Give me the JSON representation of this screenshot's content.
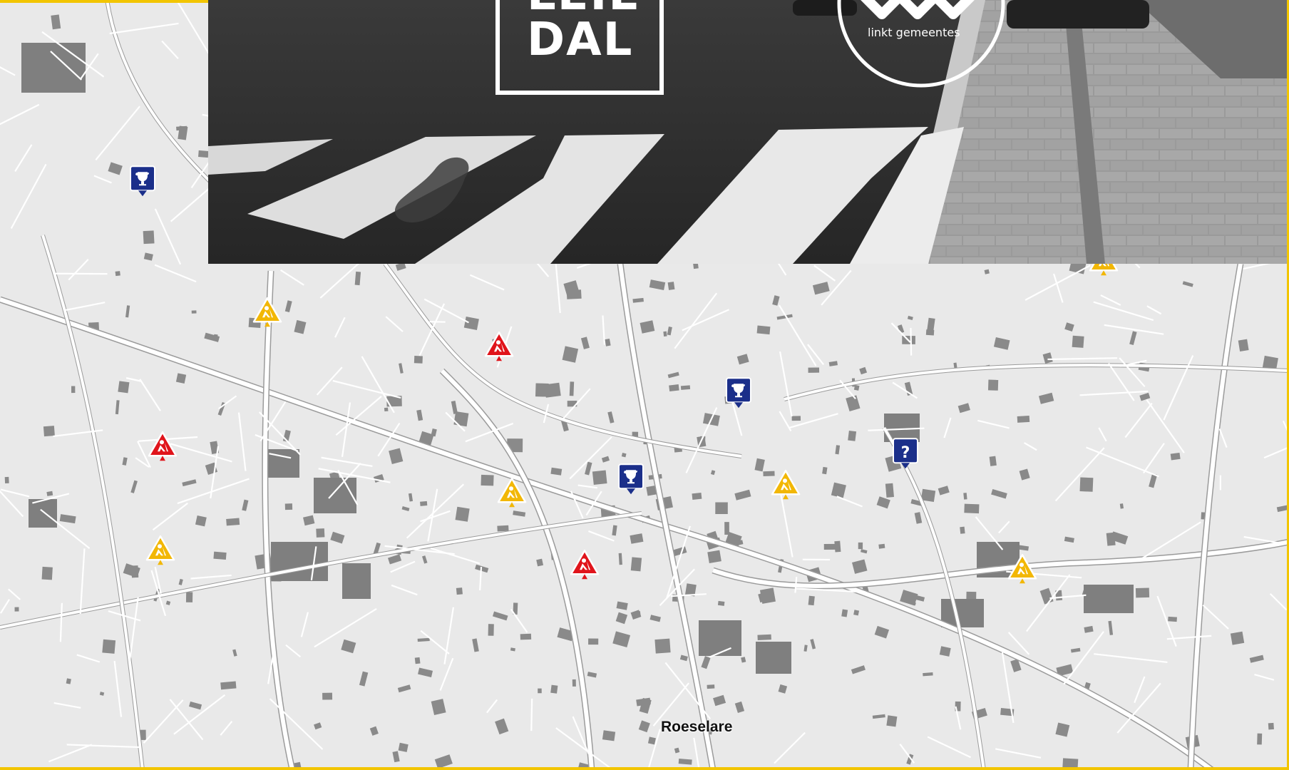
{
  "colors": {
    "accent_yellow": "#f2c500",
    "map_background": "#e9e9e9",
    "road": "#ffffff",
    "building": "#8a8a8a",
    "marker_blue": "#1b2f8a",
    "marker_yellow": "#f2b705",
    "marker_red": "#e0141b"
  },
  "hero": {
    "logo_left_line1": "LEIE",
    "logo_left_line2": "DAL",
    "logo_right_tagline": "linkt gemeentes"
  },
  "map": {
    "place_label": "Roeselare",
    "markers": [
      {
        "type": "event",
        "icon": "trophy-icon",
        "color": "blue"
      },
      {
        "type": "roadworks",
        "icon": "roadworks-icon",
        "color": "yellow"
      },
      {
        "type": "roadworks",
        "icon": "roadworks-icon",
        "color": "red"
      },
      {
        "type": "event",
        "icon": "trophy-icon",
        "color": "blue"
      },
      {
        "type": "info",
        "icon": "question-icon",
        "color": "blue"
      },
      {
        "type": "roadworks",
        "icon": "roadworks-icon",
        "color": "red"
      },
      {
        "type": "roadworks",
        "icon": "roadworks-icon",
        "color": "yellow"
      },
      {
        "type": "roadworks",
        "icon": "roadworks-icon",
        "color": "yellow"
      },
      {
        "type": "event",
        "icon": "trophy-icon",
        "color": "blue"
      },
      {
        "type": "roadworks",
        "icon": "roadworks-icon",
        "color": "yellow"
      },
      {
        "type": "roadworks",
        "icon": "roadworks-icon",
        "color": "red"
      },
      {
        "type": "roadworks",
        "icon": "roadworks-icon",
        "color": "yellow"
      },
      {
        "type": "roadworks",
        "icon": "roadworks-icon",
        "color": "yellow"
      }
    ]
  }
}
